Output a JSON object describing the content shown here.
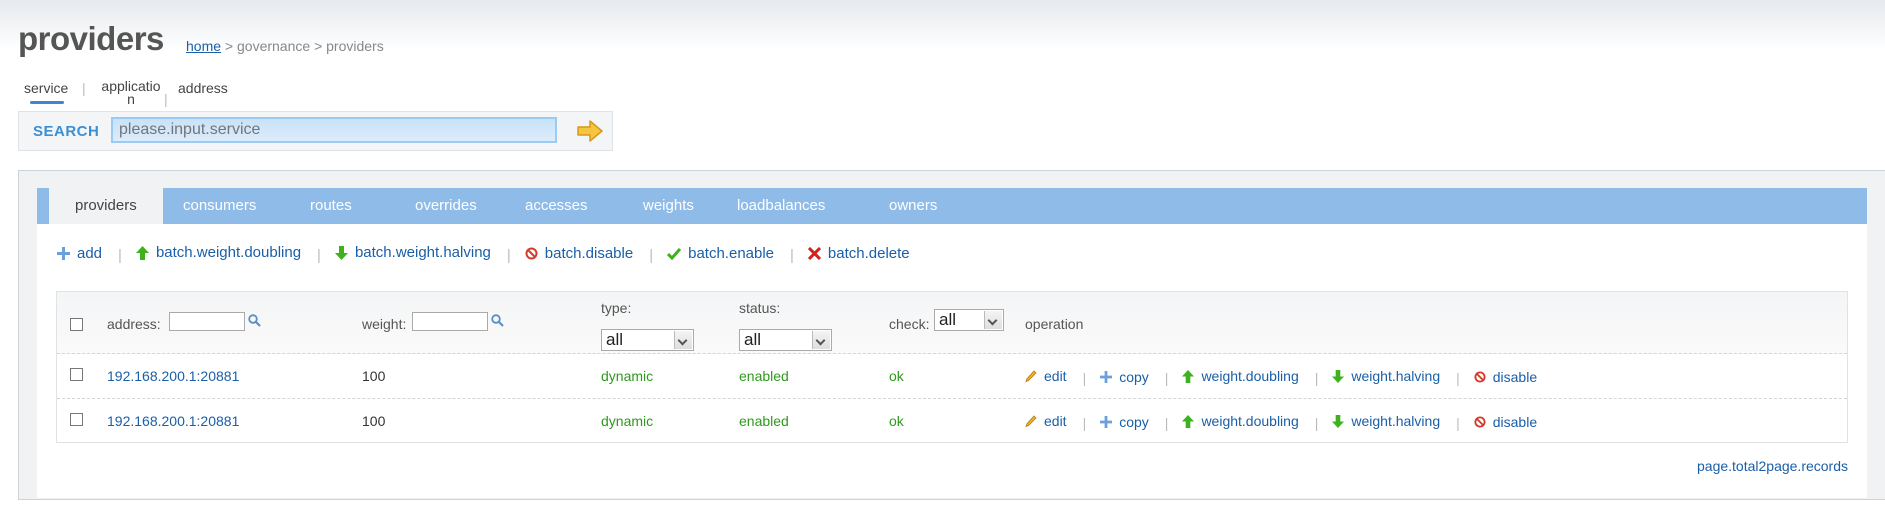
{
  "page": {
    "title": "providers",
    "breadcrumb": {
      "home": "home",
      "separator": ">",
      "middle": "governance",
      "current": "providers"
    }
  },
  "subtabs": [
    {
      "label": "service",
      "active": true
    },
    {
      "label": "application",
      "active": false
    },
    {
      "label": "address",
      "active": false
    }
  ],
  "search": {
    "label": "SEARCH",
    "placeholder": "please.input.service"
  },
  "tabs": [
    {
      "label": "providers",
      "active": true
    },
    {
      "label": "consumers"
    },
    {
      "label": "routes"
    },
    {
      "label": "overrides"
    },
    {
      "label": "accesses"
    },
    {
      "label": "weights"
    },
    {
      "label": "loadbalances"
    },
    {
      "label": "owners"
    }
  ],
  "actions": [
    {
      "label": "add",
      "icon": "plus-icon"
    },
    {
      "label": "batch.weight.doubling",
      "icon": "arrow-up-icon"
    },
    {
      "label": "batch.weight.halving",
      "icon": "arrow-down-icon"
    },
    {
      "label": "batch.disable",
      "icon": "disable-icon"
    },
    {
      "label": "batch.enable",
      "icon": "check-icon"
    },
    {
      "label": "batch.delete",
      "icon": "delete-icon"
    }
  ],
  "table": {
    "headers": {
      "address": "address:",
      "weight": "weight:",
      "type": "type:",
      "status": "status:",
      "check": "check:",
      "operation": "operation"
    },
    "filters": {
      "type": "all",
      "status": "all",
      "check": "all"
    },
    "rows": [
      {
        "address": "192.168.200.1:20881",
        "weight": "100",
        "type": "dynamic",
        "status": "enabled",
        "check": "ok"
      },
      {
        "address": "192.168.200.1:20881",
        "weight": "100",
        "type": "dynamic",
        "status": "enabled",
        "check": "ok"
      }
    ],
    "operations": [
      "edit",
      "copy",
      "weight.doubling",
      "weight.halving",
      "disable"
    ]
  },
  "pager": {
    "text": "page.total2page.records"
  },
  "colors": {
    "tabbar": "#8ebbe8",
    "link": "#1a5fa8",
    "green": "#2e9a1c",
    "search_label": "#3b8fd5"
  }
}
